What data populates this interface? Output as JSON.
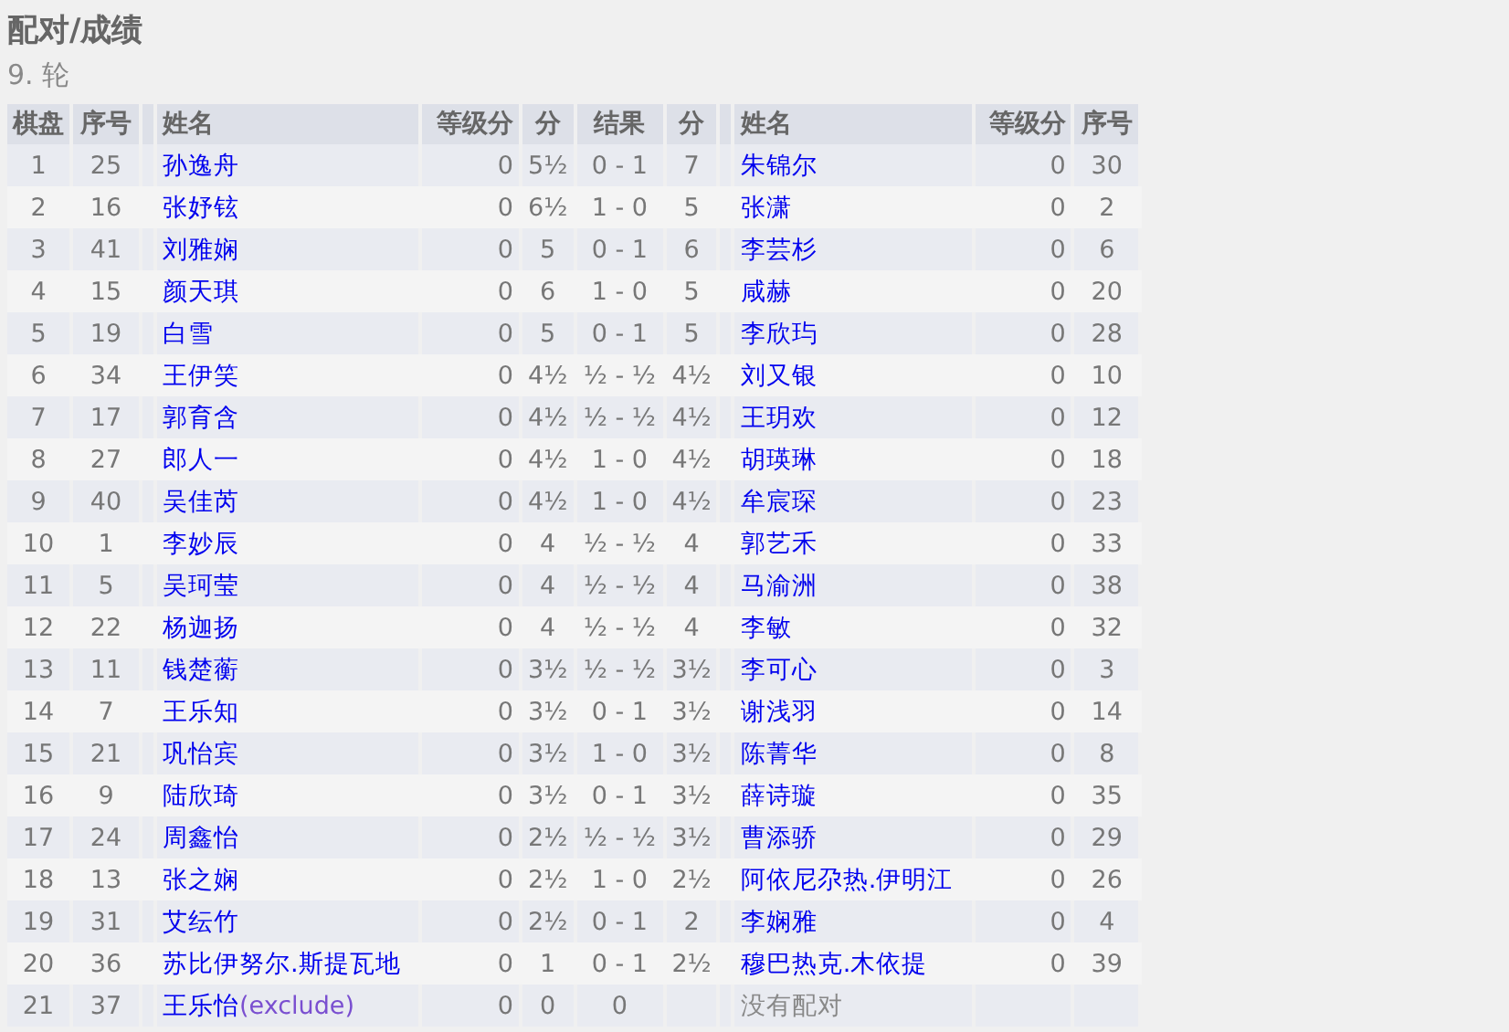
{
  "page": {
    "title": "配对/成绩",
    "round": "9. 轮"
  },
  "table": {
    "columns": [
      "棋盘",
      "序号",
      "姓名",
      "等级分",
      "分",
      "结果",
      "分",
      "姓名",
      "等级分",
      "序号"
    ],
    "rows": [
      {
        "board": "1",
        "no": "25",
        "name": "孙逸舟",
        "rating": "0",
        "points": "5½",
        "result": "0 - 1",
        "opponent": {
          "points": "7",
          "name": "朱锦尔",
          "rating": "0",
          "no": "30"
        }
      },
      {
        "board": "2",
        "no": "16",
        "name": "张妤铉",
        "rating": "0",
        "points": "6½",
        "result": "1 - 0",
        "opponent": {
          "points": "5",
          "name": "张潇",
          "rating": "0",
          "no": "2"
        }
      },
      {
        "board": "3",
        "no": "41",
        "name": "刘雅娴",
        "rating": "0",
        "points": "5",
        "result": "0 - 1",
        "opponent": {
          "points": "6",
          "name": "李芸杉",
          "rating": "0",
          "no": "6"
        }
      },
      {
        "board": "4",
        "no": "15",
        "name": "颜天琪",
        "rating": "0",
        "points": "6",
        "result": "1 - 0",
        "opponent": {
          "points": "5",
          "name": "咸赫",
          "rating": "0",
          "no": "20"
        }
      },
      {
        "board": "5",
        "no": "19",
        "name": "白雪",
        "rating": "0",
        "points": "5",
        "result": "0 - 1",
        "opponent": {
          "points": "5",
          "name": "李欣玙",
          "rating": "0",
          "no": "28"
        }
      },
      {
        "board": "6",
        "no": "34",
        "name": "王伊笑",
        "rating": "0",
        "points": "4½",
        "result": "½ - ½",
        "opponent": {
          "points": "4½",
          "name": "刘又银",
          "rating": "0",
          "no": "10"
        }
      },
      {
        "board": "7",
        "no": "17",
        "name": "郭育含",
        "rating": "0",
        "points": "4½",
        "result": "½ - ½",
        "opponent": {
          "points": "4½",
          "name": "王玥欢",
          "rating": "0",
          "no": "12"
        }
      },
      {
        "board": "8",
        "no": "27",
        "name": "郎人一",
        "rating": "0",
        "points": "4½",
        "result": "1 - 0",
        "opponent": {
          "points": "4½",
          "name": "胡瑛琳",
          "rating": "0",
          "no": "18"
        }
      },
      {
        "board": "9",
        "no": "40",
        "name": "吴佳芮",
        "rating": "0",
        "points": "4½",
        "result": "1 - 0",
        "opponent": {
          "points": "4½",
          "name": "牟宸琛",
          "rating": "0",
          "no": "23"
        }
      },
      {
        "board": "10",
        "no": "1",
        "name": "李妙辰",
        "rating": "0",
        "points": "4",
        "result": "½ - ½",
        "opponent": {
          "points": "4",
          "name": "郭艺禾",
          "rating": "0",
          "no": "33"
        }
      },
      {
        "board": "11",
        "no": "5",
        "name": "吴珂莹",
        "rating": "0",
        "points": "4",
        "result": "½ - ½",
        "opponent": {
          "points": "4",
          "name": "马渝洲",
          "rating": "0",
          "no": "38"
        }
      },
      {
        "board": "12",
        "no": "22",
        "name": "杨迦扬",
        "rating": "0",
        "points": "4",
        "result": "½ - ½",
        "opponent": {
          "points": "4",
          "name": "李敏",
          "rating": "0",
          "no": "32"
        }
      },
      {
        "board": "13",
        "no": "11",
        "name": "钱楚蘅",
        "rating": "0",
        "points": "3½",
        "result": "½ - ½",
        "opponent": {
          "points": "3½",
          "name": "李可心",
          "rating": "0",
          "no": "3"
        }
      },
      {
        "board": "14",
        "no": "7",
        "name": "王乐知",
        "rating": "0",
        "points": "3½",
        "result": "0 - 1",
        "opponent": {
          "points": "3½",
          "name": "谢浅羽",
          "rating": "0",
          "no": "14"
        }
      },
      {
        "board": "15",
        "no": "21",
        "name": "巩怡宾",
        "rating": "0",
        "points": "3½",
        "result": "1 - 0",
        "opponent": {
          "points": "3½",
          "name": "陈菁华",
          "rating": "0",
          "no": "8"
        }
      },
      {
        "board": "16",
        "no": "9",
        "name": "陆欣琦",
        "rating": "0",
        "points": "3½",
        "result": "0 - 1",
        "opponent": {
          "points": "3½",
          "name": "薛诗璇",
          "rating": "0",
          "no": "35"
        }
      },
      {
        "board": "17",
        "no": "24",
        "name": "周鑫怡",
        "rating": "0",
        "points": "2½",
        "result": "½ - ½",
        "opponent": {
          "points": "3½",
          "name": "曹添骄",
          "rating": "0",
          "no": "29"
        }
      },
      {
        "board": "18",
        "no": "13",
        "name": "张之娴",
        "rating": "0",
        "points": "2½",
        "result": "1 - 0",
        "opponent": {
          "points": "2½",
          "name": "阿依尼尕热.伊明江",
          "rating": "0",
          "no": "26"
        }
      },
      {
        "board": "19",
        "no": "31",
        "name": "艾纭竹",
        "rating": "0",
        "points": "2½",
        "result": "0 - 1",
        "opponent": {
          "points": "2",
          "name": "李娴雅",
          "rating": "0",
          "no": "4"
        }
      },
      {
        "board": "20",
        "no": "36",
        "name": "苏比伊努尔.斯提瓦地",
        "rating": "0",
        "points": "1",
        "result": "0 - 1",
        "opponent": {
          "points": "2½",
          "name": "穆巴热克.木依提",
          "rating": "0",
          "no": "39"
        }
      },
      {
        "board": "21",
        "no": "37",
        "name": "王乐怡",
        "note": "(exclude)",
        "rating": "0",
        "points": "0",
        "result": "0",
        "bye": "没有配对"
      }
    ]
  }
}
